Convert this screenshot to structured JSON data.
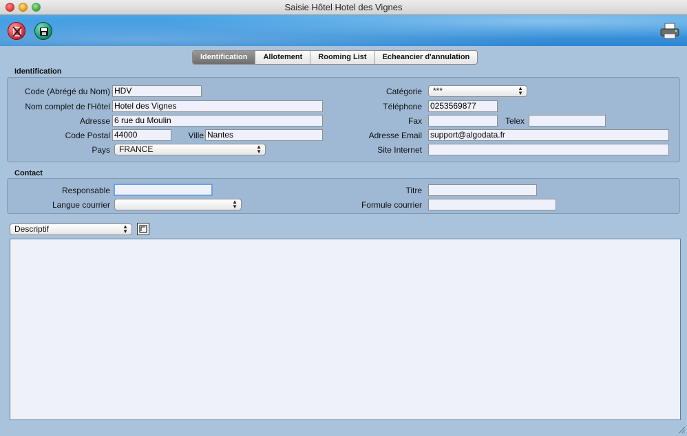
{
  "window": {
    "title": "Saisie Hôtel Hotel des Vignes"
  },
  "icons": {
    "close": "close-record-icon",
    "save": "save-icon",
    "print": "printer-icon",
    "edit": "edit-icon",
    "resize": "resize-grip-icon"
  },
  "tabs": [
    {
      "label": "Identification",
      "active": true
    },
    {
      "label": "Allotement",
      "active": false
    },
    {
      "label": "Rooming List",
      "active": false
    },
    {
      "label": "Echeancier d'annulation",
      "active": false
    }
  ],
  "identification": {
    "title": "Identification",
    "code_label": "Code  (Abrégé du Nom)",
    "code_value": "HDV",
    "nom_label": "Nom complet de l'Hôtel",
    "nom_value": "Hotel des Vignes",
    "adresse_label": "Adresse",
    "adresse_value": "6 rue du Moulin",
    "cp_label": "Code Postal",
    "cp_value": "44000",
    "ville_label": "Ville",
    "ville_value": "Nantes",
    "pays_label": "Pays",
    "pays_value": "FRANCE",
    "categorie_label": "Catégorie",
    "categorie_value": "***",
    "tel_label": "Téléphone",
    "tel_value": "0253569877",
    "fax_label": "Fax",
    "fax_value": "",
    "telex_label": "Telex",
    "telex_value": "",
    "email_label": "Adresse Email",
    "email_value": "support@algodata.fr",
    "site_label": "Site Internet",
    "site_value": ""
  },
  "contact": {
    "title": "Contact",
    "responsable_label": "Responsable",
    "responsable_value": "",
    "langue_label": "Langue courrier",
    "langue_value": "",
    "titre_label": "Titre",
    "titre_value": "",
    "formule_label": "Formule courrier",
    "formule_value": ""
  },
  "descriptif": {
    "select_value": "Descriptif",
    "text": ""
  },
  "colors": {
    "toolbar": "#2d86d2",
    "background": "#a9c3dc",
    "active_tab": "#6e6e6e"
  }
}
